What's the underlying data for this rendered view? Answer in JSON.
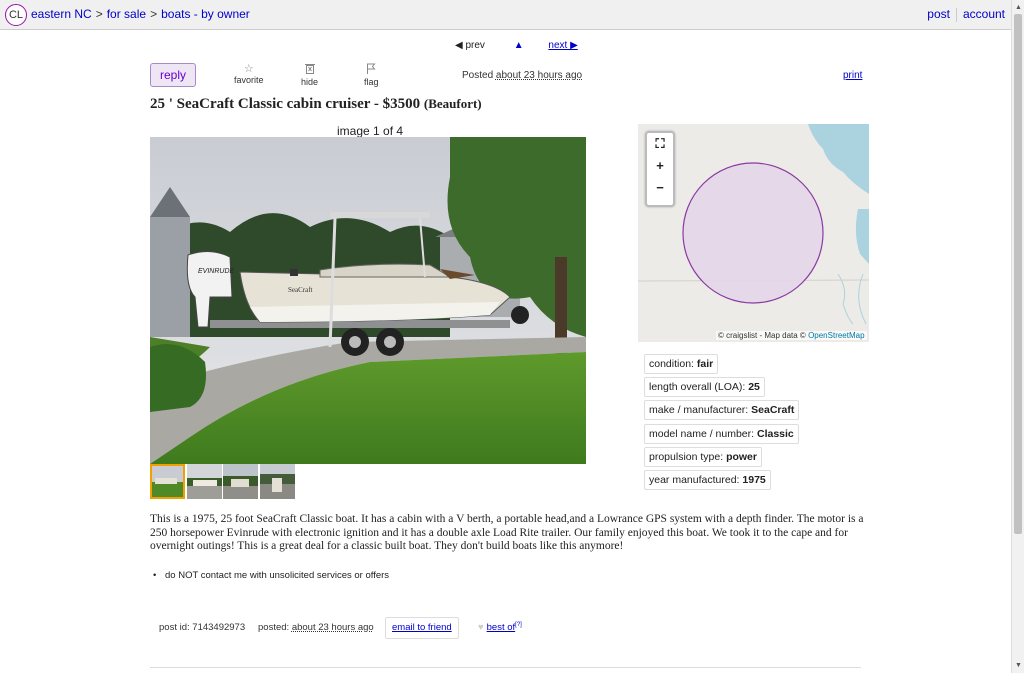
{
  "header": {
    "logo": "CL",
    "breadcrumbs": [
      "eastern NC",
      "for sale",
      "boats - by owner"
    ],
    "post_label": "post",
    "account_label": "account"
  },
  "pager": {
    "prev": "◀ prev",
    "up": "▲",
    "next": "next ▶"
  },
  "actions": {
    "reply": "reply",
    "favorite": "favorite",
    "hide": "hide",
    "flag": "flag",
    "posted_label": "Posted",
    "posted_time": "about 23 hours ago",
    "print": "print"
  },
  "listing": {
    "title": "25 ' SeaCraft Classic cabin cruiser - $3500",
    "location": "(Beaufort)",
    "image_counter": "image 1 of 4",
    "thumbnail_count": 4,
    "selected_thumbnail": 1
  },
  "map": {
    "attribution_prefix": "© craigslist - Map data ©",
    "attribution_link": "OpenStreetMap"
  },
  "attributes": [
    {
      "label": "condition:",
      "value": "fair"
    },
    {
      "label": "length overall (LOA):",
      "value": "25"
    },
    {
      "label": "make / manufacturer:",
      "value": "SeaCraft"
    },
    {
      "label": "model name / number:",
      "value": "Classic"
    },
    {
      "label": "propulsion type:",
      "value": "power"
    },
    {
      "label": "year manufactured:",
      "value": "1975"
    }
  ],
  "description": "This is a 1975, 25 foot SeaCraft Classic boat. It has a cabin with a V berth, a portable head,and a Lowrance GPS system with a depth finder. The motor is a 250 horsepower Evinrude with electronic ignition and it has a double axle Load Rite trailer. Our family enjoyed this boat. We took it to the cape and for overnight outings! This is a great deal for a classic built boat. They don't build boats like this anymore!",
  "notice": "do NOT contact me with unsolicited services or offers",
  "footer": {
    "post_id_label": "post id:",
    "post_id": "7143492973",
    "posted_label": "posted:",
    "posted_time": "about 23 hours ago",
    "email_friend": "email to friend",
    "best_of": "best of",
    "best_of_sup": "[?]"
  },
  "colors": {
    "link": "#0000cc",
    "reply_bg": "#eee6f5",
    "map_circle": "#e4d6e8",
    "map_circle_stroke": "#8a3aa0"
  }
}
